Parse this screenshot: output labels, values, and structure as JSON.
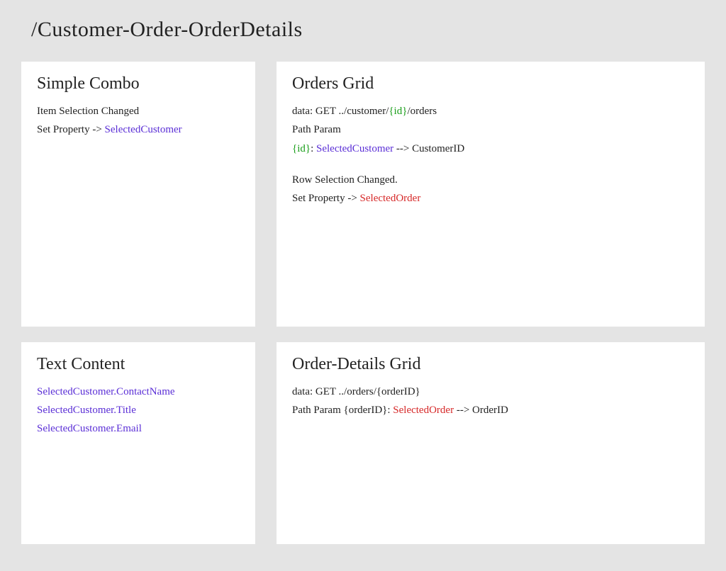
{
  "title": "/Customer-Order-OrderDetails",
  "combo": {
    "heading": "Simple Combo",
    "line1": "Item Selection Changed",
    "line2_prefix": "Set Property -> ",
    "line2_prop": "SelectedCustomer"
  },
  "textcontent": {
    "heading": "Text Content",
    "l1": "SelectedCustomer.ContactName",
    "l2": "SelectedCustomer.Title",
    "l3": "SelectedCustomer.Email"
  },
  "orders": {
    "heading": "Orders Grid",
    "data_lbl": "data:   GET ../customer/",
    "data_id": "{id}",
    "data_tail": "/orders",
    "pathparam_lbl": "Path  Param",
    "pp_id": "{id}",
    "pp_mid": ": ",
    "pp_prop": "SelectedCustomer",
    "pp_tail": " --> CustomerID",
    "rowsel": "Row Selection Changed.",
    "setprop_prefix": "Set Property -> ",
    "setprop_prop": "SelectedOrder"
  },
  "orderdetails": {
    "heading": "Order-Details Grid",
    "data_line": "data:   GET ../orders/{orderID}",
    "pp_prefix": "Path Param {orderID}: ",
    "pp_prop": "SelectedOrder",
    "pp_tail": " --> OrderID"
  }
}
